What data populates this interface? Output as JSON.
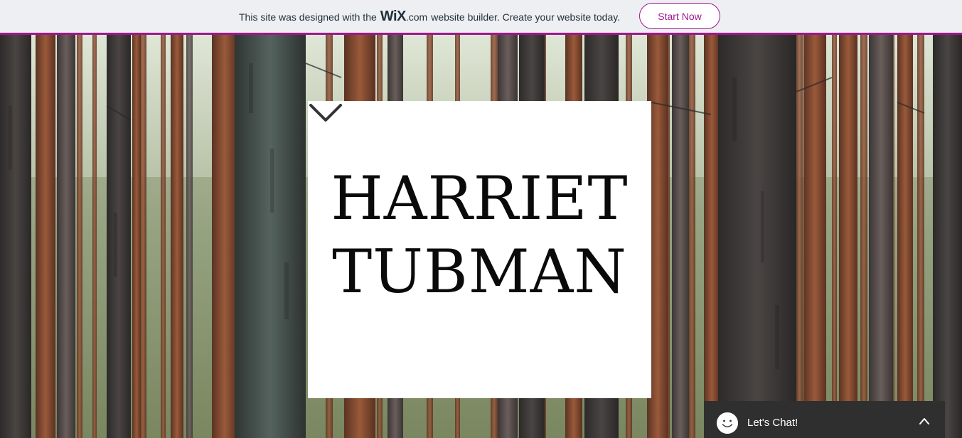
{
  "banner": {
    "text_before": "This site was designed with the",
    "logo": "WiX",
    "logo_suffix": ".com",
    "text_after": "website builder. Create your website today.",
    "cta_label": "Start Now",
    "accent_color": "#a0158f"
  },
  "hero": {
    "title_line1": "HARRIET",
    "title_line2": "TUBMAN",
    "scroll_icon": "chevron-down-icon",
    "background_image": "pine forest"
  },
  "chat": {
    "label": "Let's Chat!",
    "avatar_icon": "smiley-icon",
    "toggle_icon": "chevron-up-icon"
  }
}
